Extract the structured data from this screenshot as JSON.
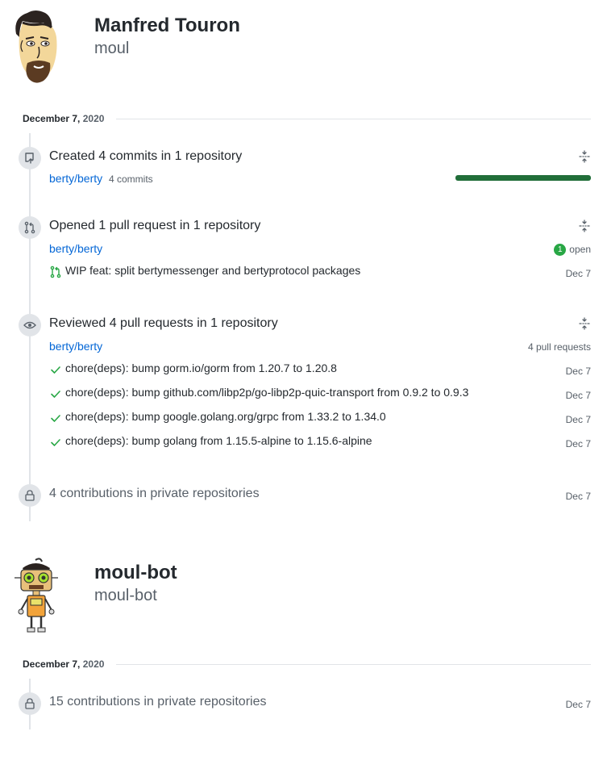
{
  "users": [
    {
      "full_name": "Manfred Touron",
      "login": "moul",
      "date": {
        "month_day": "December 7,",
        "year": "2020"
      },
      "created": {
        "title": "Created 4 commits in 1 repository",
        "repo": "berty/berty",
        "commit_count": "4 commits",
        "progress_fraction": 1.0
      },
      "opened": {
        "title": "Opened 1 pull request in 1 repository",
        "repo": "berty/berty",
        "badge_count": "1",
        "badge_label": "open",
        "items": [
          {
            "title": "WIP feat: split bertymessenger and bertyprotocol packages",
            "date": "Dec 7"
          }
        ]
      },
      "reviewed": {
        "title": "Reviewed 4 pull requests in 1 repository",
        "repo": "berty/berty",
        "count_label": "4 pull requests",
        "items": [
          {
            "title": "chore(deps): bump gorm.io/gorm from 1.20.7 to 1.20.8",
            "date": "Dec 7"
          },
          {
            "title": "chore(deps): bump github.com/libp2p/go-libp2p-quic-transport from 0.9.2 to 0.9.3",
            "date": "Dec 7"
          },
          {
            "title": "chore(deps): bump google.golang.org/grpc from 1.33.2 to 1.34.0",
            "date": "Dec 7"
          },
          {
            "title": "chore(deps): bump golang from 1.15.5-alpine to 1.15.6-alpine",
            "date": "Dec 7"
          }
        ]
      },
      "private": {
        "title": "4 contributions in private repositories",
        "date": "Dec 7"
      }
    },
    {
      "full_name": "moul-bot",
      "login": "moul-bot",
      "date": {
        "month_day": "December 7,",
        "year": "2020"
      },
      "private": {
        "title": "15 contributions in private repositories",
        "date": "Dec 7"
      }
    }
  ],
  "colors": {
    "link": "#0366d6",
    "progress": "#216e39",
    "open_badge": "#28a745",
    "check": "#28a745",
    "timeline": "#e1e4e8"
  },
  "icons": {
    "created": "repo-push-icon",
    "opened": "git-pull-request-icon",
    "reviewed": "eye-icon",
    "private": "lock-icon",
    "collapse": "fold-icon",
    "review_item": "check-icon"
  }
}
